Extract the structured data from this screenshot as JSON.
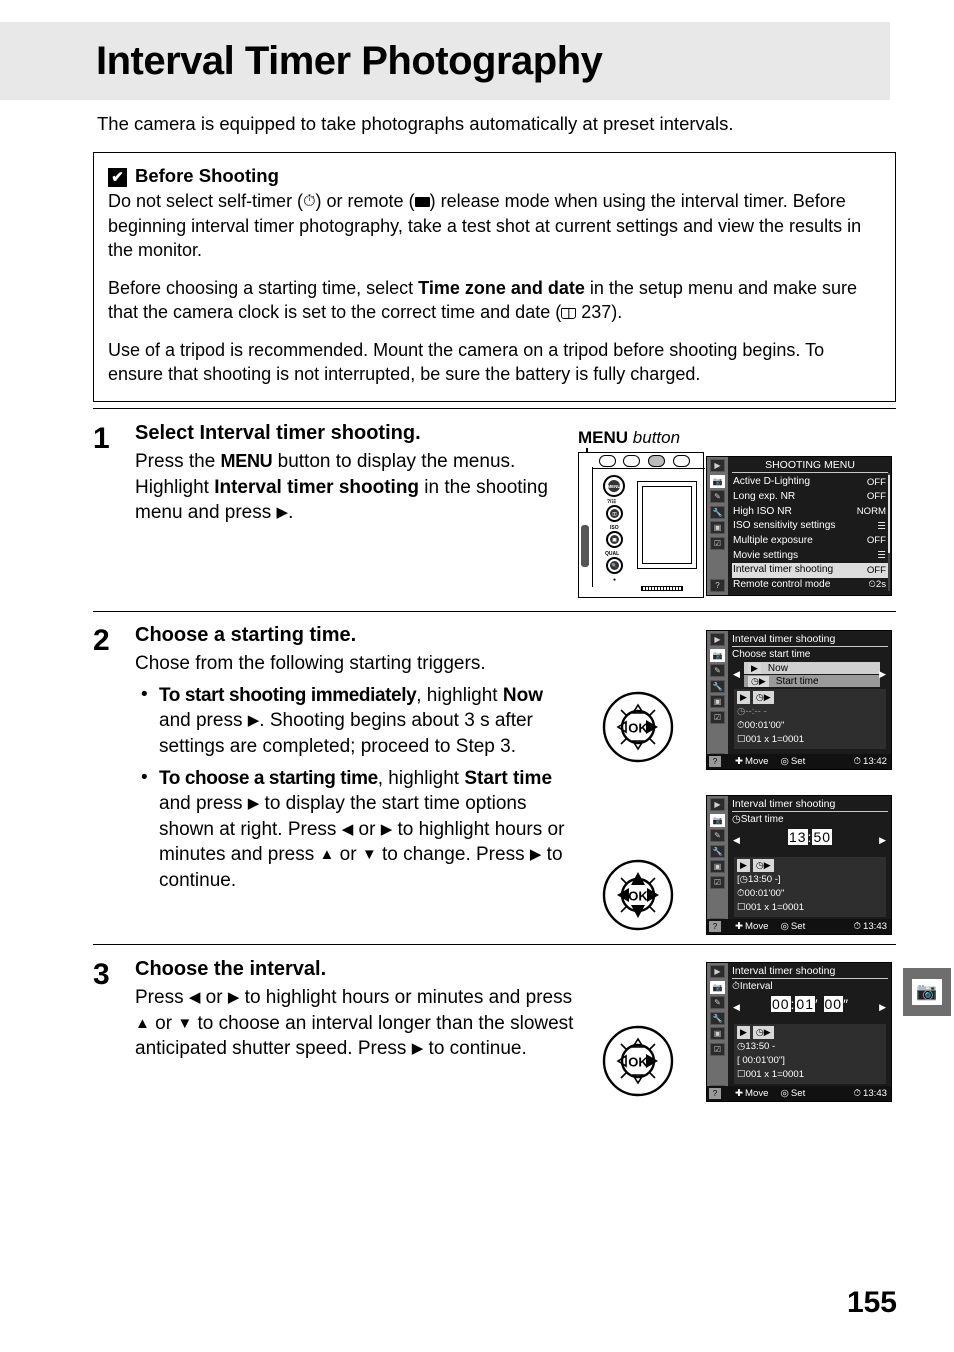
{
  "page": {
    "title": "Interval Timer Photography",
    "intro": "The camera is equipped to take photographs automatically at preset intervals.",
    "page_number": "155"
  },
  "warning": {
    "mark": "✔",
    "heading": "Before Shooting",
    "p1_a": "Do not select self-timer (",
    "p1_selftimer_icon": "self-timer-icon",
    "p1_b": ") or remote (",
    "p1_remote_icon": "remote-icon",
    "p1_c": ") release mode when using the interval timer. Before beginning interval timer photography, take a test shot at current settings and view the results in the monitor.",
    "p2_a": "Before choosing a starting time, select ",
    "p2_bold": "Time zone and date",
    "p2_b": " in the setup menu and make sure that the  camera clock is set to the correct time and date (",
    "p2_ref": " 237).",
    "p3": "Use of a tripod is recommended.  Mount the camera on a tripod before shooting begins.  To ensure that shooting is not interrupted, be sure the battery is fully charged."
  },
  "steps": [
    {
      "number": "1",
      "title_a": "Select ",
      "title_bold": "Interval timer shooting.",
      "text_a": "Press the ",
      "menu_word": "MENU",
      "text_b": " button to display the menus. Highlight ",
      "text_bold": "Interval timer shooting",
      "text_c": " in the shooting menu and press ",
      "text_d": "."
    },
    {
      "number": "2",
      "title": "Choose a starting time.",
      "text": "Chose from the following starting triggers.",
      "bullets": [
        {
          "lead": "To start shooting immediately",
          "rest_a": ", highlight ",
          "bold": "Now",
          "rest_b": " and press ",
          "rest_c": ".  Shooting begins about 3 s after settings are completed; proceed to Step 3."
        },
        {
          "lead": "To choose a starting time",
          "rest_a": ", highlight ",
          "bold": "Start time",
          "rest_b": " and press ",
          "rest_c": " to display the start time options shown at right. Press ",
          "rest_d": " or ",
          "rest_e": " to highlight hours or minutes and press ",
          "rest_f": " or ",
          "rest_g": " to change.  Press ",
          "rest_h": " to continue."
        }
      ]
    },
    {
      "number": "3",
      "title": "Choose the interval.",
      "text_a": "Press ",
      "text_b": " or ",
      "text_c": " to highlight hours or minutes and press ",
      "text_d": " or ",
      "text_e": " to choose an interval longer than the slowest anticipated shutter speed.  Press ",
      "text_f": " to continue."
    }
  ],
  "camera_illustration": {
    "label_bold": "MENU",
    "label_italic": " button",
    "buttons": [
      {
        "name": "menu-button",
        "glyph": "MENU"
      },
      {
        "name": "zoom-out-help-button",
        "glyph": "⊟",
        "label": "?/Key"
      },
      {
        "name": "iso-button",
        "glyph": "⊞",
        "label": "ISO"
      },
      {
        "name": "qual-button",
        "glyph": "⌕",
        "label": "QUAL"
      }
    ]
  },
  "lcd_shooting_menu": {
    "title": "SHOOTING MENU",
    "rows": [
      {
        "label": "Active D-Lighting",
        "value": "OFF",
        "highlight": false
      },
      {
        "label": "Long exp. NR",
        "value": "OFF",
        "highlight": false
      },
      {
        "label": "High ISO NR",
        "value": "NORM",
        "highlight": false
      },
      {
        "label": "ISO sensitivity settings",
        "value": "☰",
        "highlight": false
      },
      {
        "label": "Multiple exposure",
        "value": "OFF",
        "highlight": false
      },
      {
        "label": "Movie settings",
        "value": "☰",
        "highlight": false
      },
      {
        "label": "Interval timer shooting",
        "value": "OFF",
        "highlight": true
      },
      {
        "label": "Remote control mode",
        "value": "2s",
        "highlight": false
      }
    ],
    "side_icons": [
      "playback-icon",
      "shooting-menu-icon",
      "custom-settings-icon",
      "setup-menu-icon",
      "retouch-icon",
      "my-menu-icon",
      "help-icon"
    ]
  },
  "lcd_choose_start": {
    "title": "Interval timer shooting",
    "subtitle": "Choose start time",
    "option_now": "Now",
    "option_start_time": "Start time",
    "panel_start": "--:-- -",
    "panel_interval": "00:01'00\"",
    "panel_count": "001 x 1=0001",
    "foot_move": "Move",
    "foot_set": "Set",
    "foot_time": "13:42"
  },
  "lcd_start_time": {
    "title": "Interval timer shooting",
    "subtitle": "Start time",
    "hours": "13",
    "minutes": "50",
    "separator": ":",
    "panel_start": "13:50  -",
    "panel_interval": "00:01'00\"",
    "panel_count": "001 x 1=0001",
    "foot_move": "Move",
    "foot_set": "Set",
    "foot_time": "13:43"
  },
  "lcd_interval": {
    "title": "Interval timer shooting",
    "subtitle": "Interval",
    "hours": "00",
    "minutes": "01",
    "seconds": "00",
    "panel_start": "13:50  -",
    "panel_interval": "[ 00:01'00\"]",
    "panel_count": "001 x 1=0001",
    "foot_move": "Move",
    "foot_set": "Set",
    "foot_time": "13:43"
  },
  "side_tab": {
    "icon": "shooting-menu-camera-icon",
    "glyph": "📷"
  },
  "glyphs": {
    "right": "▶",
    "left": "◀",
    "up": "▲",
    "down": "▼"
  }
}
